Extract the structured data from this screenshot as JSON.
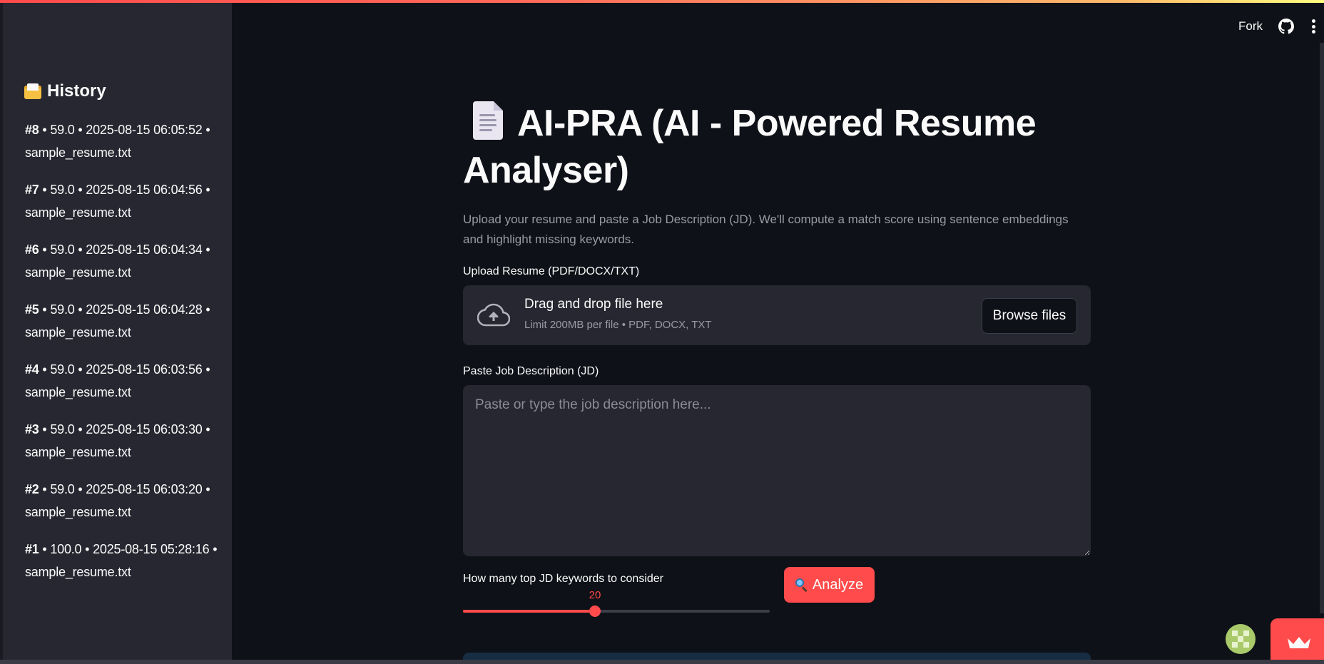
{
  "header": {
    "fork_label": "Fork",
    "github_icon": "github-icon",
    "menu_icon": "kebab-menu-icon"
  },
  "sidebar": {
    "title": "History",
    "title_icon": "clipboard-icon",
    "items": [
      {
        "id": "#8",
        "rest": " • 59.0 • 2025-08-15 06:05:52 • sample_resume.txt"
      },
      {
        "id": "#7",
        "rest": " • 59.0 • 2025-08-15 06:04:56 • sample_resume.txt"
      },
      {
        "id": "#6",
        "rest": " • 59.0 • 2025-08-15 06:04:34 • sample_resume.txt"
      },
      {
        "id": "#5",
        "rest": " • 59.0 • 2025-08-15 06:04:28 • sample_resume.txt"
      },
      {
        "id": "#4",
        "rest": " • 59.0 • 2025-08-15 06:03:56 • sample_resume.txt"
      },
      {
        "id": "#3",
        "rest": " • 59.0 • 2025-08-15 06:03:30 • sample_resume.txt"
      },
      {
        "id": "#2",
        "rest": " • 59.0 • 2025-08-15 06:03:20 • sample_resume.txt"
      },
      {
        "id": "#1",
        "rest": " • 100.0 • 2025-08-15 05:28:16 • sample_resume.txt"
      }
    ]
  },
  "main": {
    "title": "AI-PRA (AI - Powered Resume Analyser)",
    "title_icon": "document-icon",
    "subtitle": "Upload your resume and paste a Job Description (JD). We'll compute a match score using sentence embeddings and highlight missing keywords.",
    "upload": {
      "label": "Upload Resume (PDF/DOCX/TXT)",
      "drag_text": "Drag and drop file here",
      "limit_text": "Limit 200MB per file • PDF, DOCX, TXT",
      "browse_label": "Browse files",
      "icon": "cloud-upload-icon"
    },
    "jd": {
      "label": "Paste Job Description (JD)",
      "placeholder": "Paste or type the job description here...",
      "value": ""
    },
    "slider": {
      "label": "How many top JD keywords to consider",
      "value": 20,
      "value_text": "20",
      "fraction": 0.43
    },
    "analyze_label": "Analyze",
    "analyze_icon": "magnifier-icon"
  },
  "colors": {
    "accent": "#ff4b4b",
    "background": "#0e1117",
    "sidebar": "#262730",
    "muted_text": "#9a9aa6"
  }
}
